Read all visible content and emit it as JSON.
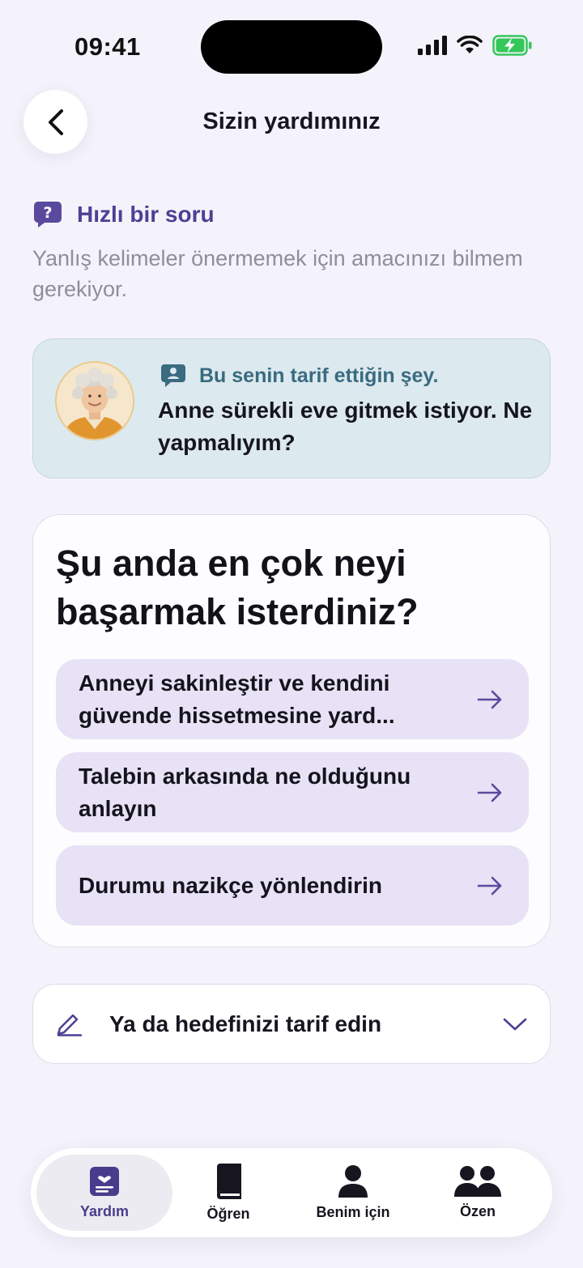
{
  "status_bar": {
    "time": "09:41"
  },
  "header": {
    "title": "Sizin yardımınız"
  },
  "quick_question": {
    "title": "Hızlı bir soru",
    "text": "Yanlış kelimeler önermemek için amacınızı bilmem gerekiyor."
  },
  "description_card": {
    "label": "Bu senin tarif ettiğin şey.",
    "text": "Anne sürekli eve gitmek istiyor. Ne yapmalıyım?"
  },
  "goal_card": {
    "title": "Şu anda en çok neyi başarmak isterdiniz?",
    "options": [
      {
        "label": "Anneyi sakinleştir ve kendini güvende hissetmesine yard..."
      },
      {
        "label": "Talebin arkasında ne olduğunu anlayın"
      },
      {
        "label": "Durumu nazikçe yönlendirin"
      }
    ]
  },
  "describe_goal": {
    "label": "Ya da hedefinizi tarif edin"
  },
  "tabs": [
    {
      "label": "Yardım",
      "icon": "help-card-icon",
      "active": true
    },
    {
      "label": "Öğren",
      "icon": "book-icon",
      "active": false
    },
    {
      "label": "Benim için",
      "icon": "person-icon",
      "active": false
    },
    {
      "label": "Özen",
      "icon": "people-icon",
      "active": false
    }
  ],
  "colors": {
    "accent": "#4f3f93",
    "background": "#f4f3fb",
    "description_card": "#dce9ee",
    "option_bg": "#e7e2f5",
    "battery": "#34c759"
  }
}
